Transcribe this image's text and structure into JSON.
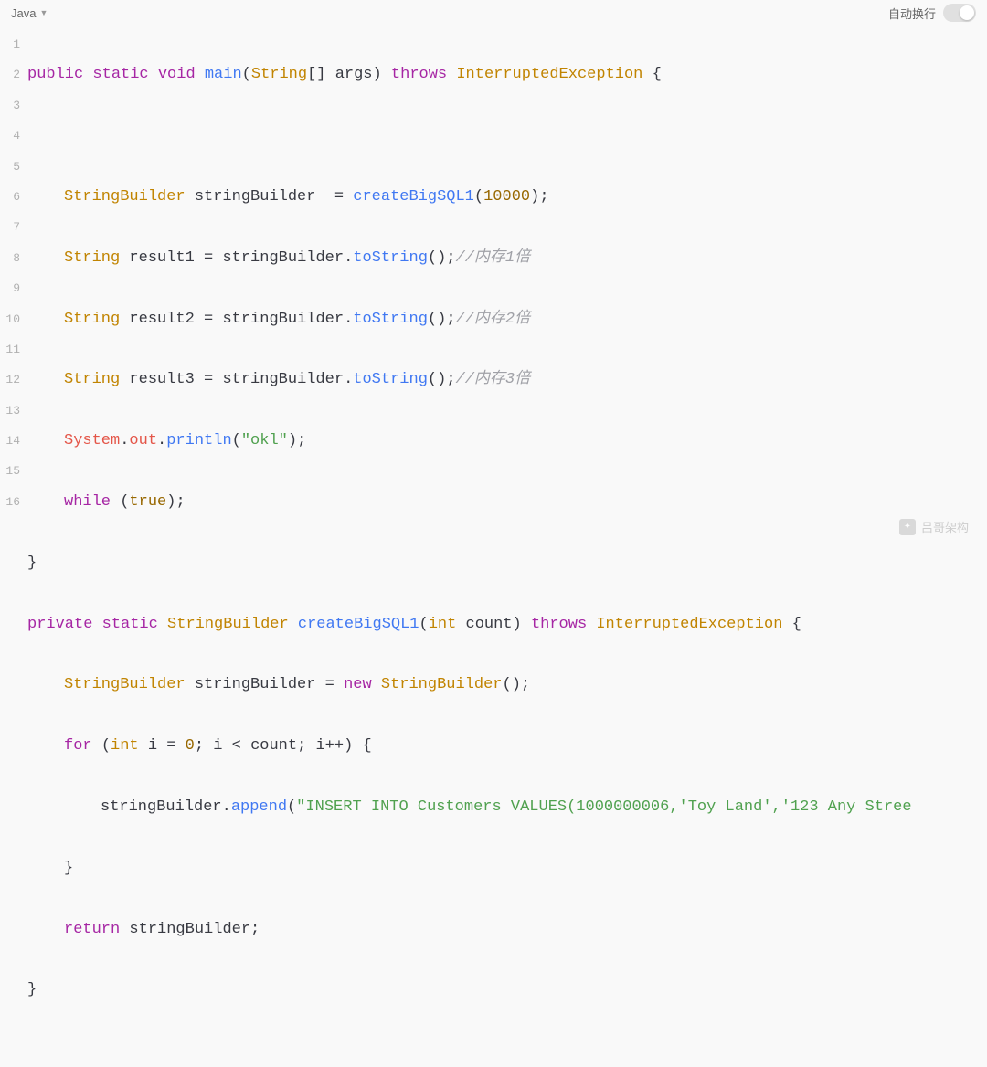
{
  "toolbar": {
    "language": "Java",
    "wrap_label": "自动换行"
  },
  "watermark": {
    "text": "吕哥架构"
  },
  "code": {
    "line1": {
      "kw_public": "public",
      "kw_static": "static",
      "kw_void": "void",
      "fn": "main",
      "type_string": "String",
      "brackets": "[]",
      "arg": "args",
      "kw_throws": "throws",
      "exc": "InterruptedException",
      "brace": "{"
    },
    "line3": {
      "type": "StringBuilder",
      "var": "stringBuilder",
      "eq": "=",
      "fn": "createBigSQL1",
      "num": "10000"
    },
    "line4": {
      "type": "String",
      "var": "result1",
      "eq": "=",
      "src": "stringBuilder",
      "call": "toString",
      "cmt": "//内存1倍"
    },
    "line5": {
      "type": "String",
      "var": "result2",
      "eq": "=",
      "src": "stringBuilder",
      "call": "toString",
      "cmt": "//内存2倍"
    },
    "line6": {
      "type": "String",
      "var": "result3",
      "eq": "=",
      "src": "stringBuilder",
      "call": "toString",
      "cmt": "//内存3倍"
    },
    "line7": {
      "cls": "System",
      "field": "out",
      "call": "println",
      "str": "\"okl\""
    },
    "line8": {
      "kw": "while",
      "bool": "true"
    },
    "line9": {
      "brace": "}"
    },
    "line10": {
      "kw_private": "private",
      "kw_static": "static",
      "type": "StringBuilder",
      "fn": "createBigSQL1",
      "ptype": "int",
      "pname": "count",
      "kw_throws": "throws",
      "exc": "InterruptedException",
      "brace": "{"
    },
    "line11": {
      "type": "StringBuilder",
      "var": "stringBuilder",
      "eq": "=",
      "kw_new": "new",
      "ctor": "StringBuilder"
    },
    "line12": {
      "kw_for": "for",
      "itype": "int",
      "ivar": "i",
      "eq": "=",
      "start": "0",
      "cmp_var": "i",
      "cmp_op": "<",
      "cmp_end": "count",
      "inc": "i++",
      "brace": "{"
    },
    "line13": {
      "var": "stringBuilder",
      "call": "append",
      "str": "\"INSERT INTO Customers VALUES(1000000006,'Toy Land','123 Any Stree"
    },
    "line14": {
      "brace": "}"
    },
    "line15": {
      "kw": "return",
      "var": "stringBuilder"
    },
    "line16": {
      "brace": "}"
    }
  },
  "line_numbers": [
    "1",
    "2",
    "3",
    "4",
    "5",
    "6",
    "7",
    "8",
    "9",
    "10",
    "11",
    "12",
    "13",
    "14",
    "15",
    "16"
  ]
}
